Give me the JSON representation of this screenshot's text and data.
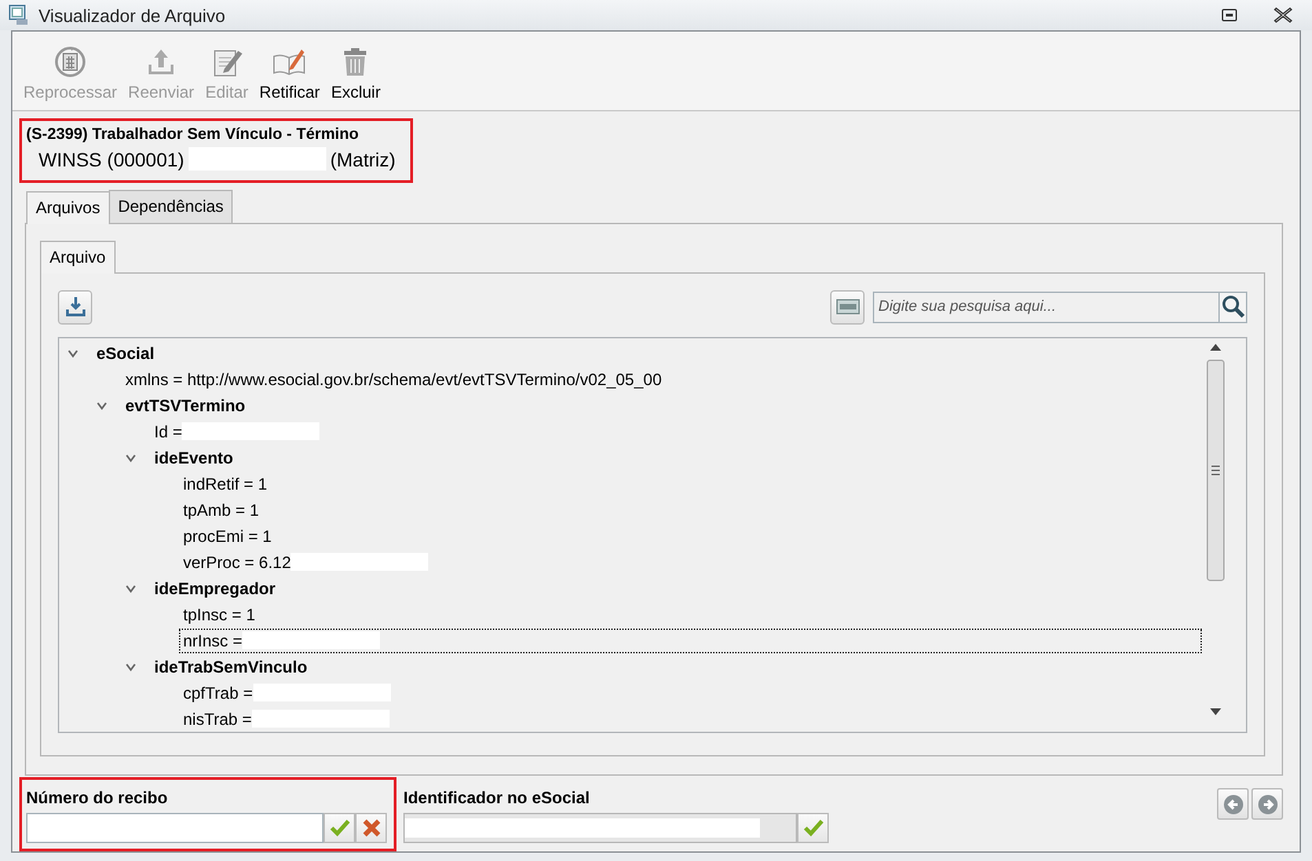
{
  "window": {
    "title": "Visualizador de Arquivo"
  },
  "toolbar": [
    {
      "kind": "reprocess",
      "label": "Reprocessar",
      "disabled": true
    },
    {
      "kind": "resend",
      "label": "Reenviar",
      "disabled": true
    },
    {
      "kind": "edit",
      "label": "Editar",
      "disabled": true
    },
    {
      "kind": "rectify",
      "label": "Retificar",
      "disabled": false
    },
    {
      "kind": "delete",
      "label": "Excluir",
      "disabled": false
    }
  ],
  "header": {
    "title": "(S-2399) Trabalhador Sem Vínculo - Término",
    "company": "WINSS (000001)",
    "company_redacted": true,
    "branch": "(Matriz)",
    "highlighted": true
  },
  "tabs": [
    {
      "label": "Arquivos",
      "selected": true
    },
    {
      "label": "Dependências",
      "selected": false
    }
  ],
  "inner_tabs": [
    {
      "label": "Arquivo",
      "selected": true
    }
  ],
  "search": {
    "placeholder": "Digite sua pesquisa aqui..."
  },
  "tree": [
    {
      "kind": "element",
      "label": "eSocial",
      "expanded": true,
      "selected": false,
      "children": [
        {
          "kind": "attribute",
          "label": "xmlns = http://www.esocial.gov.br/schema/evt/evtTSVTermino/v02_05_00",
          "selected": false,
          "redacted": false
        },
        {
          "kind": "element",
          "label": "evtTSVTermino",
          "expanded": true,
          "selected": false,
          "children": [
            {
              "kind": "attribute",
              "label": "Id =",
              "selected": false,
              "redacted": true
            },
            {
              "kind": "element",
              "label": "ideEvento",
              "expanded": true,
              "selected": false,
              "children": [
                {
                  "kind": "attribute",
                  "label": "indRetif = 1",
                  "selected": false,
                  "redacted": false
                },
                {
                  "kind": "attribute",
                  "label": "tpAmb = 1",
                  "selected": false,
                  "redacted": false
                },
                {
                  "kind": "attribute",
                  "label": "procEmi = 1",
                  "selected": false,
                  "redacted": false
                },
                {
                  "kind": "attribute",
                  "label": "verProc = 6.12",
                  "selected": false,
                  "redacted": true
                }
              ]
            },
            {
              "kind": "element",
              "label": "ideEmpregador",
              "expanded": true,
              "selected": false,
              "children": [
                {
                  "kind": "attribute",
                  "label": "tpInsc = 1",
                  "selected": false,
                  "redacted": false
                },
                {
                  "kind": "attribute",
                  "label": "nrInsc =",
                  "selected": true,
                  "redacted": true
                }
              ]
            },
            {
              "kind": "element",
              "label": "ideTrabSemVinculo",
              "expanded": true,
              "selected": false,
              "children": [
                {
                  "kind": "attribute",
                  "label": "cpfTrab =",
                  "selected": false,
                  "redacted": true
                },
                {
                  "kind": "attribute",
                  "label": "nisTrab =",
                  "selected": false,
                  "redacted": true
                }
              ]
            }
          ]
        }
      ]
    }
  ],
  "receipt": {
    "label": "Número do recibo",
    "highlighted": true
  },
  "esocial_id": {
    "label": "Identificador no eSocial",
    "redacted": true,
    "disabled": true
  }
}
